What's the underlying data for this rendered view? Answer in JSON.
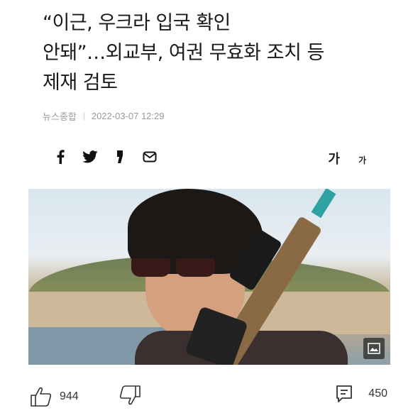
{
  "article": {
    "headline_lines": [
      "“이근, 우크라 입국 확인",
      "안돼”…외교부, 여권 무효화 조치 등",
      "제재 검토"
    ],
    "source": "뉴스종합",
    "datetime": "2022-03-07 12:29"
  },
  "share": {
    "icons": [
      "facebook-icon",
      "twitter-icon",
      "kakaostory-icon",
      "mail-icon"
    ]
  },
  "font_size": {
    "large_label": "가",
    "small_label": "가"
  },
  "photo": {
    "expand_icon": "image-icon"
  },
  "reactions": {
    "like_count": "944",
    "comment_count": "450"
  }
}
